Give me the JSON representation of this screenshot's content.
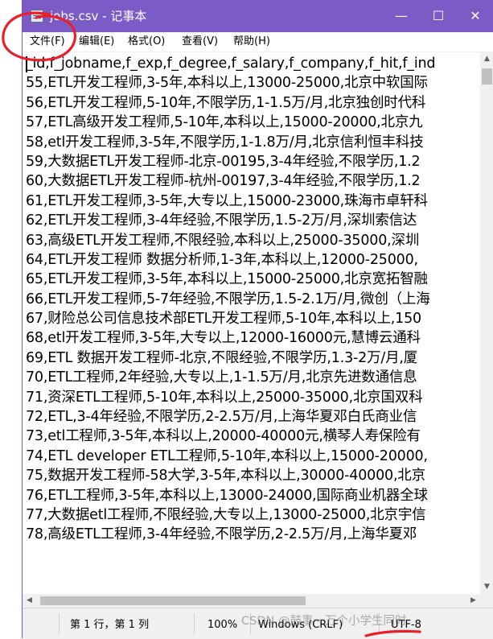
{
  "window": {
    "title": "jobs.csv - 记事本",
    "minimize_glyph": "—",
    "maximize_glyph": "☐",
    "close_glyph": "✕"
  },
  "menu": [
    "文件(F)",
    "编辑(E)",
    "格式(O)",
    "查看(V)",
    "帮助(H)"
  ],
  "editor": {
    "lines": [
      "_id,f_jobname,f_exp,f_degree,f_salary,f_company,f_hit,f_ind",
      "55,ETL开发工程师,3-5年,本科以上,13000-25000,北京中软国际",
      "56,ETL开发工程师,5-10年,不限学历,1-1.5万/月,北京独创时代科",
      "57,ETL高级开发工程师,5-10年,本科以上,15000-20000,北京九",
      "58,etl开发工程师,3-5年,不限学历,1-1.8万/月,北京信利恒丰科技",
      "59,大数据ETL开发工程师-北京-00195,3-4年经验,不限学历,1.2",
      "60,大数据ETL开发工程师-杭州-00197,3-4年经验,不限学历,1.2",
      "61,ETL开发工程师,3-5年,大专以上,15000-23000,珠海市卓轩科",
      "62,ETL开发工程师,3-4年经验,不限学历,1.5-2万/月,深圳索信达",
      "63,高级ETL开发工程师,不限经验,本科以上,25000-35000,深圳",
      "64,ETL开发工程师 数据分析师,1-3年,本科以上,12000-25000,",
      "65,ETL开发工程师,3-5年,本科以上,15000-25000,北京宽拓智融",
      "66,ETL开发工程师,5-7年经验,不限学历,1.5-2.1万/月,微创（上海",
      "67,财险总公司信息技术部ETL开发工程师,5-10年,本科以上,150",
      "68,etl开发工程师,3-5年,大专以上,12000-16000元,慧博云通科",
      "69,ETL 数据开发工程师-北京,不限经验,不限学历,1.3-2万/月,厦",
      "70,ETL工程师,2年经验,大专以上,1-1.5万/月,北京先进数通信息",
      "71,资深ETL工程师,5-10年,本科以上,25000-35000,北京国双科",
      "72,ETL,3-4年经验,不限学历,2-2.5万/月,上海华夏邓白氏商业信",
      "73,etl工程师,3-5年,本科以上,20000-40000元,横琴人寿保险有",
      "74,ETL developer ETL工程师,5-10年,本科以上,15000-20000,",
      "75,数据开发工程师-58大学,3-5年,本科以上,30000-40000,北京",
      "76,ETL工程师,3-5年,本科以上,13000-24000,国际商业机器全球",
      "77,大数据etl工程师,不限经验,大专以上,13000-25000,北京宇信",
      "78,高级ETL工程师,3-4年经验,不限学历,2-2.5万/月,上海华夏邓"
    ]
  },
  "scroll": {
    "up_arrow": "▲",
    "down_arrow": "▼",
    "left_arrow": "◀",
    "right_arrow": "▶"
  },
  "status": {
    "position": "第 1 行，第 1 列",
    "zoom": "100%",
    "line_ending": "Windows (CRLF)",
    "encoding": "UTF-8"
  },
  "watermark": "CSDN @鼓事一万个小学生同时",
  "colors": {
    "titlebar": "#7b5bc6",
    "annotation": "#e8202a"
  }
}
